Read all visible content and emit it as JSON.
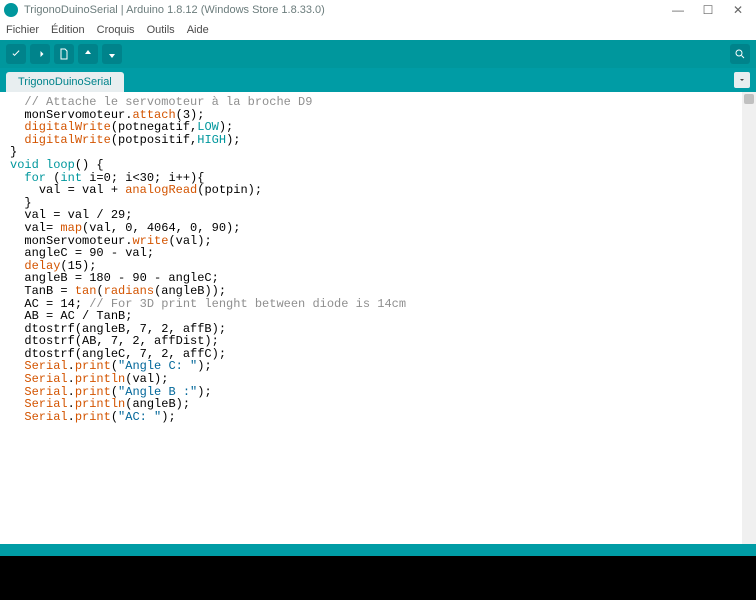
{
  "window": {
    "title": "TrigonoDuinoSerial | Arduino 1.8.12 (Windows Store 1.8.33.0)"
  },
  "menubar": {
    "items": [
      "Fichier",
      "Édition",
      "Croquis",
      "Outils",
      "Aide"
    ]
  },
  "tabs": {
    "active": "TrigonoDuinoSerial"
  },
  "code": {
    "lines": [
      {
        "indent": 1,
        "segs": [
          {
            "cls": "c-comment",
            "t": "// Attache le servomoteur à la broche D9"
          }
        ]
      },
      {
        "indent": 1,
        "segs": [
          {
            "t": "monServomoteur."
          },
          {
            "cls": "c-member",
            "t": "attach"
          },
          {
            "t": "(3);"
          }
        ]
      },
      {
        "indent": 1,
        "segs": [
          {
            "cls": "c-func",
            "t": "digitalWrite"
          },
          {
            "t": "(potnegatif,"
          },
          {
            "cls": "c-const",
            "t": "LOW"
          },
          {
            "t": ");"
          }
        ]
      },
      {
        "indent": 1,
        "segs": [
          {
            "cls": "c-func",
            "t": "digitalWrite"
          },
          {
            "t": "(potpositif,"
          },
          {
            "cls": "c-const",
            "t": "HIGH"
          },
          {
            "t": ");"
          }
        ]
      },
      {
        "indent": 0,
        "segs": [
          {
            "t": ""
          }
        ]
      },
      {
        "indent": 0,
        "segs": [
          {
            "t": "}"
          }
        ]
      },
      {
        "indent": 0,
        "segs": [
          {
            "t": ""
          }
        ]
      },
      {
        "indent": 0,
        "segs": [
          {
            "cls": "c-kw",
            "t": "void"
          },
          {
            "t": " "
          },
          {
            "cls": "c-kw",
            "t": "loop"
          },
          {
            "t": "() {"
          }
        ]
      },
      {
        "indent": 0,
        "segs": [
          {
            "t": ""
          }
        ]
      },
      {
        "indent": 1,
        "segs": [
          {
            "cls": "c-kw",
            "t": "for"
          },
          {
            "t": " ("
          },
          {
            "cls": "c-type",
            "t": "int"
          },
          {
            "t": " i=0; i<30; i++){"
          }
        ]
      },
      {
        "indent": 2,
        "segs": [
          {
            "t": "val = val + "
          },
          {
            "cls": "c-func",
            "t": "analogRead"
          },
          {
            "t": "(potpin);"
          }
        ]
      },
      {
        "indent": 1,
        "segs": [
          {
            "t": "}"
          }
        ]
      },
      {
        "indent": 0,
        "segs": [
          {
            "t": ""
          }
        ]
      },
      {
        "indent": 1,
        "segs": [
          {
            "t": "val = val / 29;"
          }
        ]
      },
      {
        "indent": 0,
        "segs": [
          {
            "t": ""
          }
        ]
      },
      {
        "indent": 1,
        "segs": [
          {
            "t": "val= "
          },
          {
            "cls": "c-func",
            "t": "map"
          },
          {
            "t": "(val, 0, 4064, 0, 90);"
          }
        ]
      },
      {
        "indent": 1,
        "segs": [
          {
            "t": "monServomoteur."
          },
          {
            "cls": "c-member",
            "t": "write"
          },
          {
            "t": "(val);"
          }
        ]
      },
      {
        "indent": 1,
        "segs": [
          {
            "t": "angleC = 90 - val;"
          }
        ]
      },
      {
        "indent": 1,
        "segs": [
          {
            "cls": "c-func",
            "t": "delay"
          },
          {
            "t": "(15);"
          }
        ]
      },
      {
        "indent": 0,
        "segs": [
          {
            "t": ""
          }
        ]
      },
      {
        "indent": 1,
        "segs": [
          {
            "t": "angleB = 180 - 90 - angleC;"
          }
        ]
      },
      {
        "indent": 1,
        "segs": [
          {
            "t": "TanB = "
          },
          {
            "cls": "c-func",
            "t": "tan"
          },
          {
            "t": "("
          },
          {
            "cls": "c-func",
            "t": "radians"
          },
          {
            "t": "(angleB));"
          }
        ]
      },
      {
        "indent": 0,
        "segs": [
          {
            "t": ""
          }
        ]
      },
      {
        "indent": 1,
        "segs": [
          {
            "t": "AC = 14; "
          },
          {
            "cls": "c-comment",
            "t": "// For 3D print lenght between diode is 14cm"
          }
        ]
      },
      {
        "indent": 1,
        "segs": [
          {
            "t": "AB = AC / TanB;"
          }
        ]
      },
      {
        "indent": 0,
        "segs": [
          {
            "t": ""
          }
        ]
      },
      {
        "indent": 1,
        "segs": [
          {
            "t": "dtostrf(angleB, 7, 2, affB);"
          }
        ]
      },
      {
        "indent": 1,
        "segs": [
          {
            "t": "dtostrf(AB, 7, 2, affDist);"
          }
        ]
      },
      {
        "indent": 1,
        "segs": [
          {
            "t": "dtostrf(angleC, 7, 2, affC);"
          }
        ]
      },
      {
        "indent": 0,
        "segs": [
          {
            "t": ""
          }
        ]
      },
      {
        "indent": 1,
        "segs": [
          {
            "cls": "c-func",
            "t": "Serial"
          },
          {
            "t": "."
          },
          {
            "cls": "c-member",
            "t": "print"
          },
          {
            "t": "("
          },
          {
            "cls": "c-str",
            "t": "\"Angle C: \""
          },
          {
            "t": ");"
          }
        ]
      },
      {
        "indent": 1,
        "segs": [
          {
            "cls": "c-func",
            "t": "Serial"
          },
          {
            "t": "."
          },
          {
            "cls": "c-member",
            "t": "println"
          },
          {
            "t": "(val);"
          }
        ]
      },
      {
        "indent": 1,
        "segs": [
          {
            "cls": "c-func",
            "t": "Serial"
          },
          {
            "t": "."
          },
          {
            "cls": "c-member",
            "t": "print"
          },
          {
            "t": "("
          },
          {
            "cls": "c-str",
            "t": "\"Angle B :\""
          },
          {
            "t": ");"
          }
        ]
      },
      {
        "indent": 1,
        "segs": [
          {
            "cls": "c-func",
            "t": "Serial"
          },
          {
            "t": "."
          },
          {
            "cls": "c-member",
            "t": "println"
          },
          {
            "t": "(angleB);"
          }
        ]
      },
      {
        "indent": 1,
        "segs": [
          {
            "cls": "c-func",
            "t": "Serial"
          },
          {
            "t": "."
          },
          {
            "cls": "c-member",
            "t": "print"
          },
          {
            "t": "("
          },
          {
            "cls": "c-str",
            "t": "\"AC: \""
          },
          {
            "t": ");"
          }
        ]
      }
    ]
  }
}
